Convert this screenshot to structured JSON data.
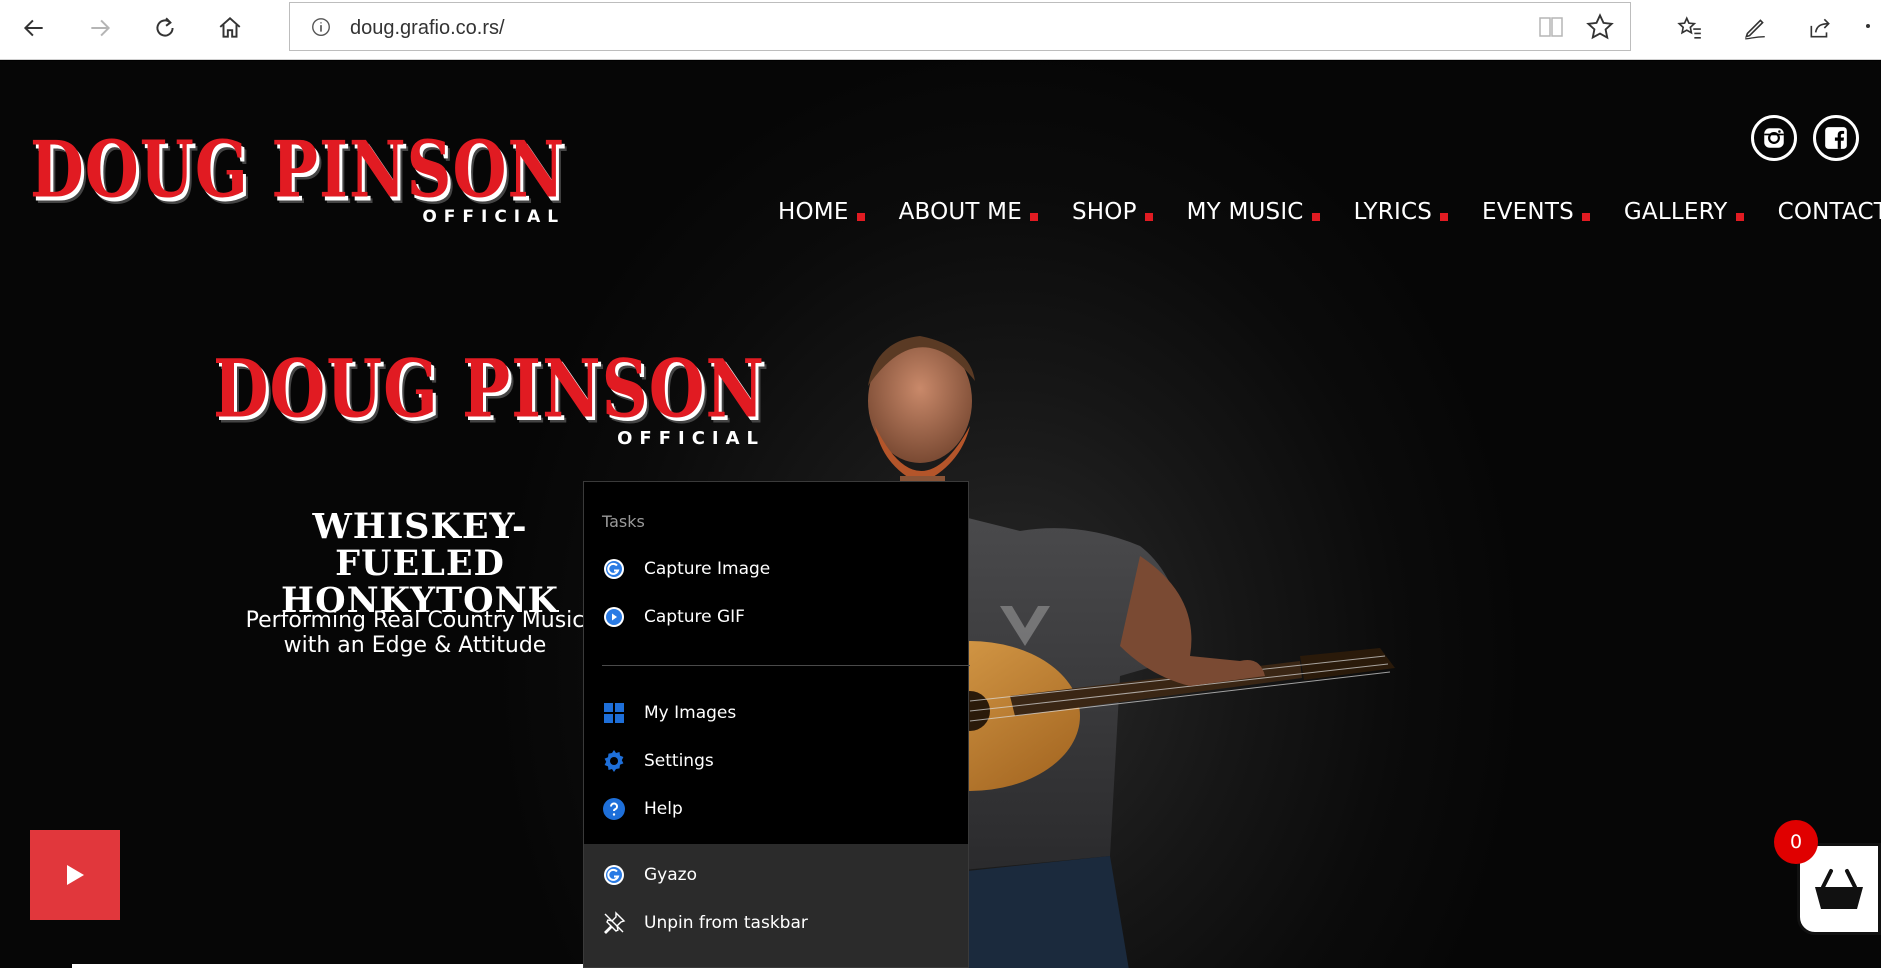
{
  "browser": {
    "url": "doug.grafio.co.rs/"
  },
  "site": {
    "logo_name": "DOUG PINSON",
    "logo_sub": "OFFICIAL",
    "nav": [
      "HOME",
      "ABOUT ME",
      "SHOP",
      "MY MUSIC",
      "LYRICS",
      "EVENTS",
      "GALLERY",
      "CONTACT"
    ],
    "hero_name": "DOUG PINSON",
    "hero_sub": "OFFICIAL",
    "tagline_line1": "WHISKEY-FUELED",
    "tagline_line2": "HONKYTONK",
    "desc_line1": "Performing Real Country Music",
    "desc_line2": "with an Edge & Attitude",
    "cart_count": "0"
  },
  "jumplist": {
    "header": "Tasks",
    "tasks": [
      "Capture Image",
      "Capture GIF"
    ],
    "items": [
      "My Images",
      "Settings",
      "Help"
    ],
    "app": "Gyazo",
    "unpin": "Unpin from taskbar"
  },
  "colors": {
    "brand_red": "#e11b22",
    "play_red": "#e1373c",
    "gyazo_blue": "#1e6fd9"
  }
}
